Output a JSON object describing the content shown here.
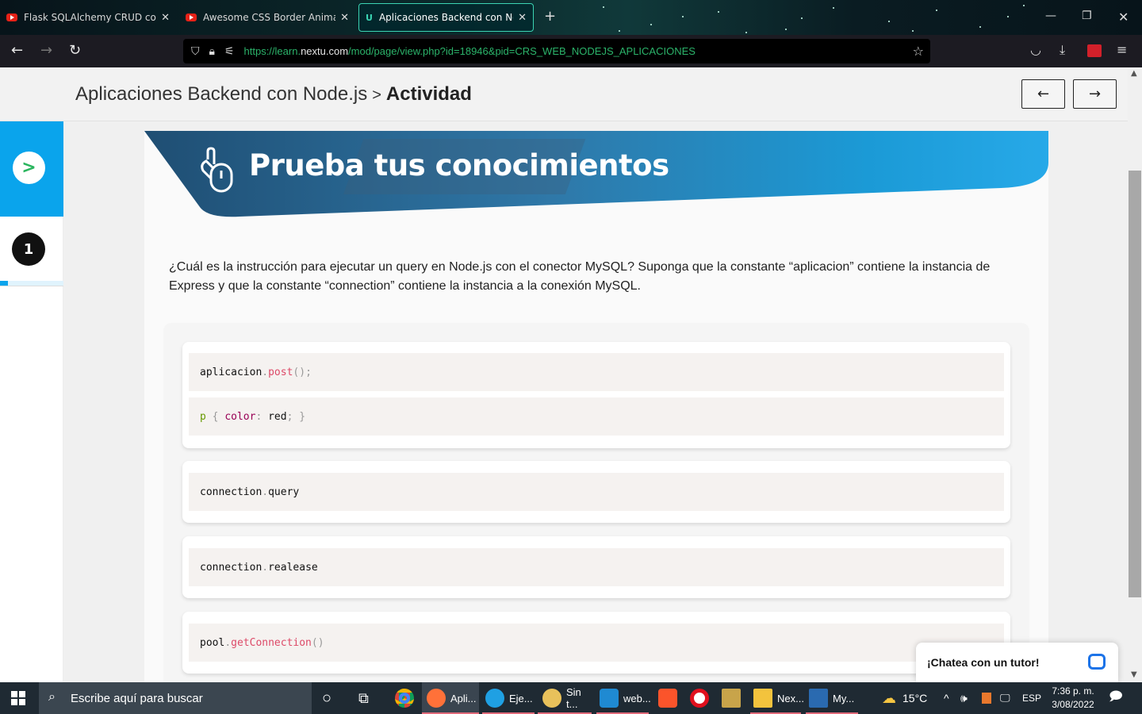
{
  "browser": {
    "tabs": [
      {
        "title": "Flask SQLAlchemy CRUD con M",
        "icon": "youtube-icon"
      },
      {
        "title": "Awesome CSS Border Animatio",
        "icon": "youtube-icon"
      },
      {
        "title": "Aplicaciones Backend con Nod",
        "icon": "nextu-icon",
        "active": true
      }
    ],
    "url_prefix": "https://learn.",
    "url_domain": "nextu.com",
    "url_rest": "/mod/page/view.php?id=18946&pid=CRS_WEB_NODEJS_APLICACIONES"
  },
  "header": {
    "course": "Aplicaciones Backend con Node.js",
    "separator": ">",
    "current": "Actividad",
    "prev_label": "←",
    "next_label": "→"
  },
  "sidebar": {
    "expand_label": ">",
    "step_number": "1"
  },
  "banner": {
    "title": "Prueba tus conocimientos"
  },
  "question": {
    "text": "¿Cuál es la instrucción para ejecutar un query en Node.js con el conector MySQL? Suponga que la constante “aplicacion” contiene la instancia de Express y que la constante “connection” contiene la instancia a la conexión MySQL."
  },
  "options": [
    {
      "lines": [
        {
          "parts": [
            [
              "aplicacion",
              ""
            ],
            [
              ".",
              "pn"
            ],
            [
              "post",
              "fn"
            ],
            [
              "();",
              "pn"
            ]
          ]
        },
        {
          "parts": [
            [
              "p",
              "sel"
            ],
            [
              " { ",
              "pn"
            ],
            [
              "color",
              "prop"
            ],
            [
              ":",
              "pn"
            ],
            [
              " red",
              ""
            ],
            [
              "; }",
              "pn"
            ]
          ]
        }
      ]
    },
    {
      "lines": [
        {
          "parts": [
            [
              "connection",
              ""
            ],
            [
              ".",
              "pn"
            ],
            [
              "query",
              ""
            ]
          ]
        }
      ]
    },
    {
      "lines": [
        {
          "parts": [
            [
              "connection",
              ""
            ],
            [
              ".",
              "pn"
            ],
            [
              "realease",
              ""
            ]
          ]
        }
      ]
    },
    {
      "lines": [
        {
          "parts": [
            [
              "pool",
              ""
            ],
            [
              ".",
              "pn"
            ],
            [
              "getConnection",
              "fn"
            ],
            [
              "()",
              "pn"
            ]
          ]
        }
      ]
    }
  ],
  "chat": {
    "label": "¡Chatea con un tutor!"
  },
  "taskbar": {
    "search_placeholder": "Escribe aquí para buscar",
    "apps": [
      {
        "label": "Apli...",
        "icon": "firefox-icon",
        "color": "#ff7139"
      },
      {
        "label": "Eje...",
        "icon": "edge-icon",
        "color": "#1fa0e3"
      },
      {
        "label": "Sin t...",
        "icon": "paint-icon",
        "color": "#e8c15b"
      },
      {
        "label": "web...",
        "icon": "vscode-icon",
        "color": "#1f8ad2"
      },
      {
        "label": "Nex...",
        "icon": "folder-icon",
        "color": "#f3c33d"
      },
      {
        "label": "My...",
        "icon": "mysql-workbench-icon",
        "color": "#2a6ab0"
      }
    ],
    "weather": "15°C",
    "lang": "ESP",
    "time": "7:36 p. m.",
    "date": "3/08/2022"
  }
}
